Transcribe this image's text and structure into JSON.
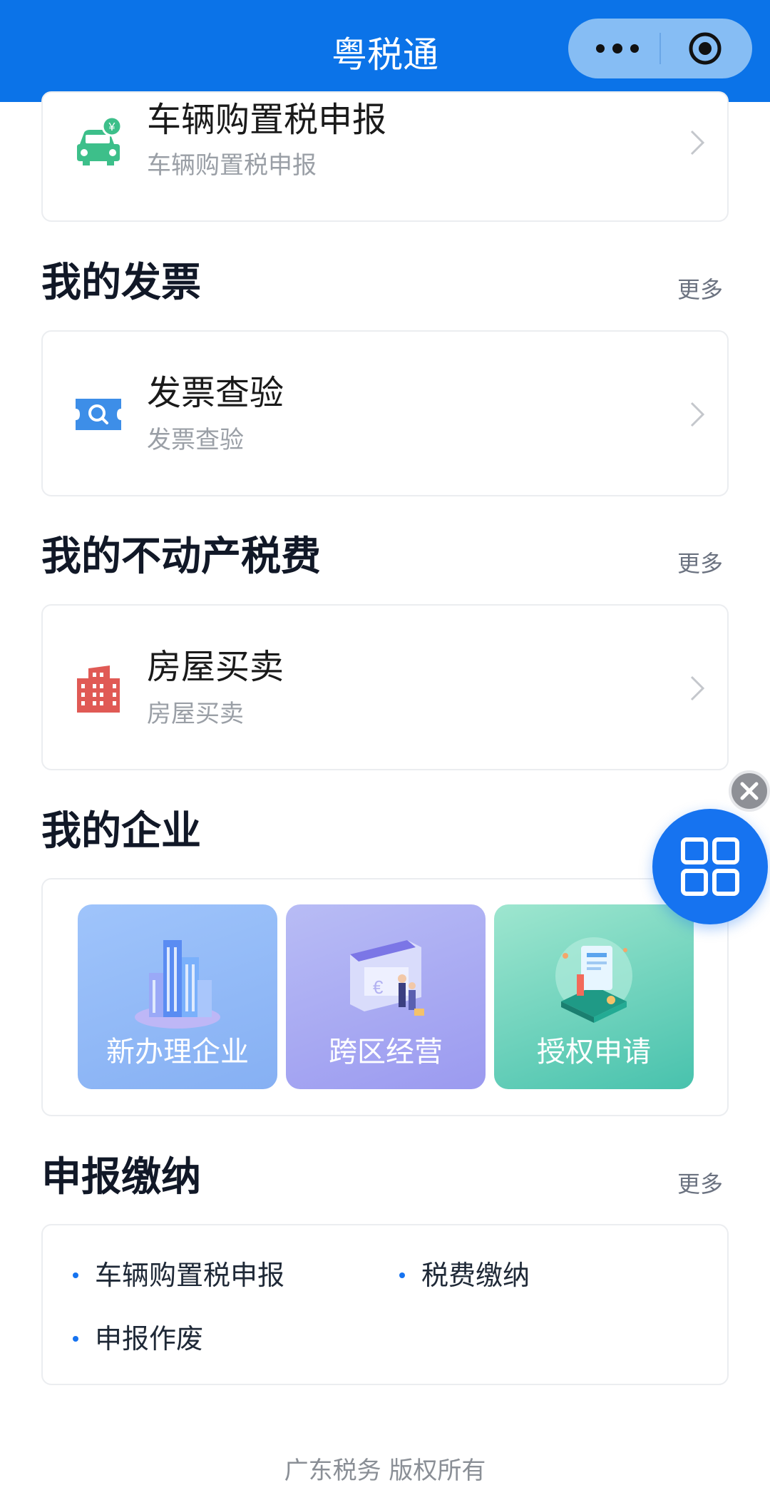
{
  "header": {
    "title": "粤税通",
    "more_icon": "more-dots-icon",
    "target_icon": "target-icon",
    "color": "#0b73e8"
  },
  "vehicle_card": {
    "title": "车辆购置税申报",
    "subtitle": "车辆购置税申报",
    "icon": "car-yuan-icon",
    "icon_badge": "¥"
  },
  "invoice_section": {
    "title": "我的发票",
    "more": "更多",
    "item": {
      "title": "发票查验",
      "subtitle": "发票查验",
      "icon": "ticket-search-icon"
    }
  },
  "property_section": {
    "title": "我的不动产税费",
    "more": "更多",
    "item": {
      "title": "房屋买卖",
      "subtitle": "房屋买卖",
      "icon": "building-icon"
    }
  },
  "enterprise_section": {
    "title": "我的企业",
    "tiles": [
      {
        "label": "新办理企业",
        "icon": "city-buildings-icon"
      },
      {
        "label": "跨区经营",
        "icon": "storefront-icon"
      },
      {
        "label": "授权申请",
        "icon": "authorization-document-icon"
      }
    ]
  },
  "declaration_section": {
    "title": "申报缴纳",
    "more": "更多",
    "links": [
      "车辆购置税申报",
      "税费缴纳",
      "申报作废"
    ]
  },
  "floating": {
    "close_icon": "close-icon",
    "apps_icon": "grid-apps-icon"
  },
  "footer": {
    "text": "广东税务 版权所有"
  },
  "colors": {
    "primary": "#1673f0",
    "vehicle_icon": "#3dbf8a",
    "invoice_icon": "#3d8ee8",
    "property_icon": "#e05a55"
  }
}
